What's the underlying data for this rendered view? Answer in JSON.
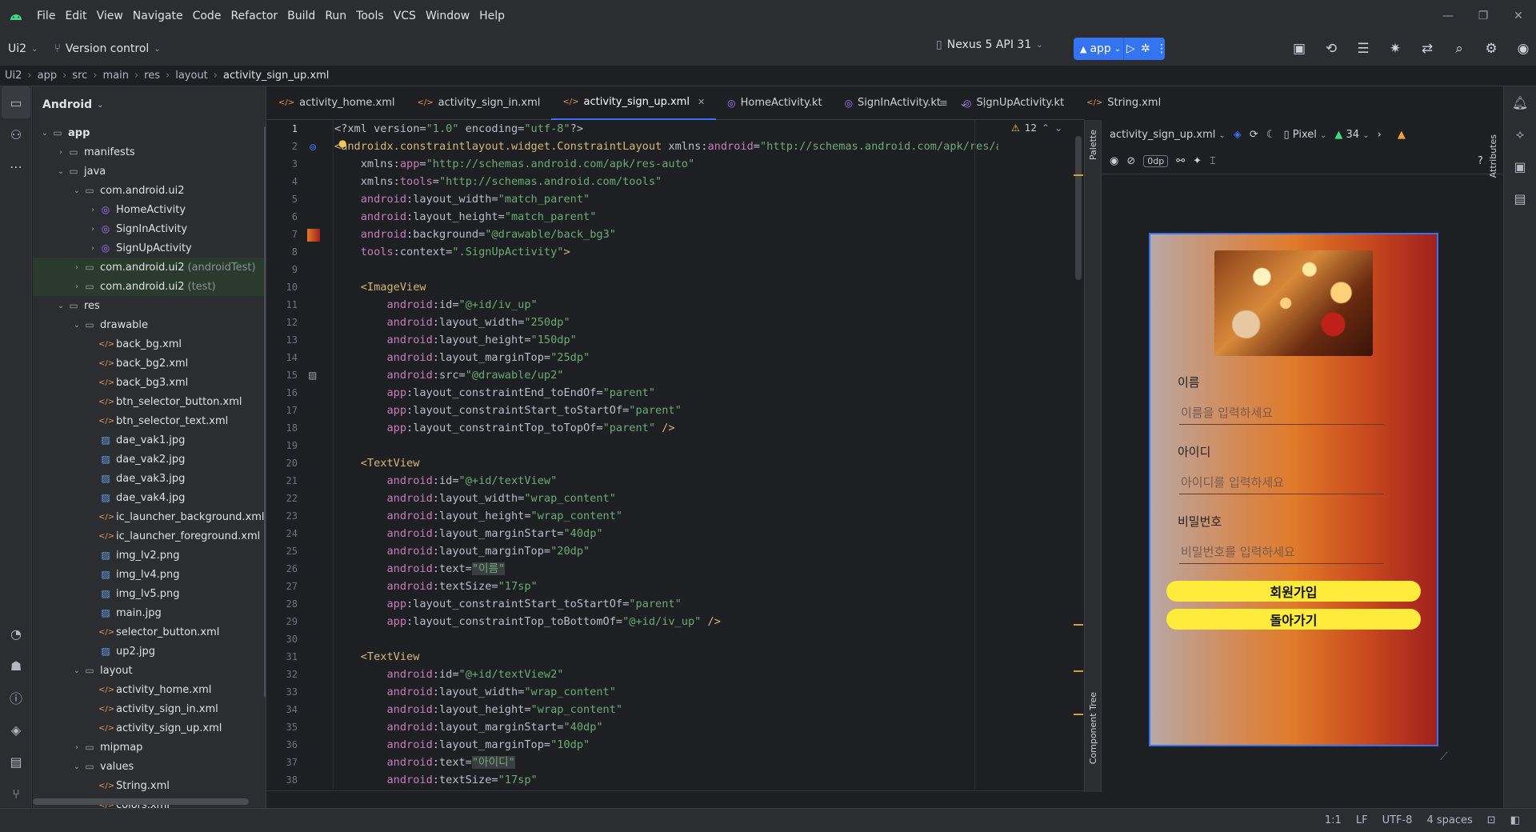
{
  "menubar": {
    "items": [
      "File",
      "Edit",
      "View",
      "Navigate",
      "Code",
      "Refactor",
      "Build",
      "Run",
      "Tools",
      "VCS",
      "Window",
      "Help"
    ]
  },
  "toolbar": {
    "project": "Ui2",
    "vcs": "Version control",
    "device": "Nexus 5 API 31",
    "run_config": "app"
  },
  "breadcrumb": [
    "Ui2",
    "app",
    "src",
    "main",
    "res",
    "layout",
    "activity_sign_up.xml"
  ],
  "project_panel": {
    "title": "Android",
    "tree": [
      {
        "depth": 0,
        "arrow": "v",
        "icon": "folder",
        "label": "app",
        "bold": true
      },
      {
        "depth": 1,
        "arrow": ">",
        "icon": "folder",
        "label": "manifests"
      },
      {
        "depth": 1,
        "arrow": "v",
        "icon": "folder",
        "label": "java"
      },
      {
        "depth": 2,
        "arrow": "v",
        "icon": "folder",
        "label": "com.android.ui2"
      },
      {
        "depth": 3,
        "arrow": ">",
        "icon": "kt",
        "label": "HomeActivity"
      },
      {
        "depth": 3,
        "arrow": ">",
        "icon": "kt",
        "label": "SignInActivity"
      },
      {
        "depth": 3,
        "arrow": ">",
        "icon": "kt",
        "label": "SignUpActivity"
      },
      {
        "depth": 2,
        "arrow": ">",
        "icon": "folder",
        "label": "com.android.ui2",
        "suffix": "(androidTest)",
        "hl": true
      },
      {
        "depth": 2,
        "arrow": ">",
        "icon": "folder",
        "label": "com.android.ui2",
        "suffix": "(test)",
        "hl": true
      },
      {
        "depth": 1,
        "arrow": "v",
        "icon": "folder",
        "label": "res"
      },
      {
        "depth": 2,
        "arrow": "v",
        "icon": "folder",
        "label": "drawable"
      },
      {
        "depth": 3,
        "arrow": "",
        "icon": "xml",
        "label": "back_bg.xml"
      },
      {
        "depth": 3,
        "arrow": "",
        "icon": "xml",
        "label": "back_bg2.xml"
      },
      {
        "depth": 3,
        "arrow": "",
        "icon": "xml",
        "label": "back_bg3.xml"
      },
      {
        "depth": 3,
        "arrow": "",
        "icon": "xml",
        "label": "btn_selector_button.xml"
      },
      {
        "depth": 3,
        "arrow": "",
        "icon": "xml",
        "label": "btn_selector_text.xml"
      },
      {
        "depth": 3,
        "arrow": "",
        "icon": "img",
        "label": "dae_vak1.jpg"
      },
      {
        "depth": 3,
        "arrow": "",
        "icon": "img",
        "label": "dae_vak2.jpg"
      },
      {
        "depth": 3,
        "arrow": "",
        "icon": "img",
        "label": "dae_vak3.jpg"
      },
      {
        "depth": 3,
        "arrow": "",
        "icon": "img",
        "label": "dae_vak4.jpg"
      },
      {
        "depth": 3,
        "arrow": "",
        "icon": "xml",
        "label": "ic_launcher_background.xml"
      },
      {
        "depth": 3,
        "arrow": "",
        "icon": "xml",
        "label": "ic_launcher_foreground.xml"
      },
      {
        "depth": 3,
        "arrow": "",
        "icon": "img",
        "label": "img_lv2.png"
      },
      {
        "depth": 3,
        "arrow": "",
        "icon": "img",
        "label": "img_lv4.png"
      },
      {
        "depth": 3,
        "arrow": "",
        "icon": "img",
        "label": "img_lv5.png"
      },
      {
        "depth": 3,
        "arrow": "",
        "icon": "img",
        "label": "main.jpg"
      },
      {
        "depth": 3,
        "arrow": "",
        "icon": "xml",
        "label": "selector_button.xml"
      },
      {
        "depth": 3,
        "arrow": "",
        "icon": "img",
        "label": "up2.jpg"
      },
      {
        "depth": 2,
        "arrow": "v",
        "icon": "folder",
        "label": "layout"
      },
      {
        "depth": 3,
        "arrow": "",
        "icon": "xml",
        "label": "activity_home.xml"
      },
      {
        "depth": 3,
        "arrow": "",
        "icon": "xml",
        "label": "activity_sign_in.xml"
      },
      {
        "depth": 3,
        "arrow": "",
        "icon": "xml",
        "label": "activity_sign_up.xml"
      },
      {
        "depth": 2,
        "arrow": ">",
        "icon": "folder",
        "label": "mipmap"
      },
      {
        "depth": 2,
        "arrow": "v",
        "icon": "folder",
        "label": "values"
      },
      {
        "depth": 3,
        "arrow": "",
        "icon": "xml",
        "label": "String.xml"
      },
      {
        "depth": 3,
        "arrow": "",
        "icon": "xml",
        "label": "colors.xml"
      }
    ]
  },
  "tabs": [
    {
      "label": "activity_home.xml",
      "type": "xml"
    },
    {
      "label": "activity_sign_in.xml",
      "type": "xml"
    },
    {
      "label": "activity_sign_up.xml",
      "type": "xml",
      "active": true
    },
    {
      "label": "HomeActivity.kt",
      "type": "kt"
    },
    {
      "label": "SignInActivity.kt",
      "type": "kt"
    },
    {
      "label": "SignUpActivity.kt",
      "type": "kt"
    },
    {
      "label": "String.xml",
      "type": "xml"
    }
  ],
  "inspections": {
    "warnings": "12"
  },
  "code_lines": [
    [
      [
        "pi",
        "<?xml version="
      ],
      [
        "vl",
        "\"1.0\""
      ],
      [
        "pi",
        " encoding="
      ],
      [
        "vl",
        "\"utf-8\""
      ],
      [
        "pi",
        "?>"
      ]
    ],
    [
      [
        "tg",
        "<androidx.constraintlayout.widget.ConstraintLayout "
      ],
      [
        "at",
        "xmlns:"
      ],
      [
        "ns",
        "android"
      ],
      [
        "at",
        "="
      ],
      [
        "vl",
        "\"http://schemas.android.com/apk/res/android\""
      ]
    ],
    [
      [
        "at",
        "    xmlns:"
      ],
      [
        "ns",
        "app"
      ],
      [
        "at",
        "="
      ],
      [
        "vl",
        "\"http://schemas.android.com/apk/res-auto\""
      ]
    ],
    [
      [
        "at",
        "    xmlns:"
      ],
      [
        "ns",
        "tools"
      ],
      [
        "at",
        "="
      ],
      [
        "vl",
        "\"http://schemas.android.com/tools\""
      ]
    ],
    [
      [
        "ns",
        "    android"
      ],
      [
        "at",
        ":layout_width="
      ],
      [
        "vl",
        "\"match_parent\""
      ]
    ],
    [
      [
        "ns",
        "    android"
      ],
      [
        "at",
        ":layout_height="
      ],
      [
        "vl",
        "\"match_parent\""
      ]
    ],
    [
      [
        "ns",
        "    android"
      ],
      [
        "at",
        ":background="
      ],
      [
        "vl",
        "\"@drawable/back_bg3\""
      ]
    ],
    [
      [
        "ns",
        "    tools"
      ],
      [
        "at",
        ":context="
      ],
      [
        "vl",
        "\".SignUpActivity\""
      ],
      [
        "tg",
        ">"
      ]
    ],
    [
      [
        "at",
        ""
      ]
    ],
    [
      [
        "tg",
        "    <ImageView"
      ]
    ],
    [
      [
        "ns",
        "        android"
      ],
      [
        "at",
        ":id="
      ],
      [
        "vl",
        "\"@+id/iv_up\""
      ]
    ],
    [
      [
        "ns",
        "        android"
      ],
      [
        "at",
        ":layout_width="
      ],
      [
        "vl",
        "\"250dp\""
      ]
    ],
    [
      [
        "ns",
        "        android"
      ],
      [
        "at",
        ":layout_height="
      ],
      [
        "vl",
        "\"150dp\""
      ]
    ],
    [
      [
        "ns",
        "        android"
      ],
      [
        "at",
        ":layout_marginTop="
      ],
      [
        "vl",
        "\"25dp\""
      ]
    ],
    [
      [
        "ns",
        "        android"
      ],
      [
        "at",
        ":src="
      ],
      [
        "vl",
        "\"@drawable/up2\""
      ]
    ],
    [
      [
        "ns",
        "        app"
      ],
      [
        "at",
        ":layout_constraintEnd_toEndOf="
      ],
      [
        "vl",
        "\"parent\""
      ]
    ],
    [
      [
        "ns",
        "        app"
      ],
      [
        "at",
        ":layout_constraintStart_toStartOf="
      ],
      [
        "vl",
        "\"parent\""
      ]
    ],
    [
      [
        "ns",
        "        app"
      ],
      [
        "at",
        ":layout_constraintTop_toTopOf="
      ],
      [
        "vl",
        "\"parent\""
      ],
      [
        "tg",
        " />"
      ]
    ],
    [
      [
        "at",
        ""
      ]
    ],
    [
      [
        "tg",
        "    <TextView"
      ]
    ],
    [
      [
        "ns",
        "        android"
      ],
      [
        "at",
        ":id="
      ],
      [
        "vl",
        "\"@+id/textView\""
      ]
    ],
    [
      [
        "ns",
        "        android"
      ],
      [
        "at",
        ":layout_width="
      ],
      [
        "vl",
        "\"wrap_content\""
      ]
    ],
    [
      [
        "ns",
        "        android"
      ],
      [
        "at",
        ":layout_height="
      ],
      [
        "vl",
        "\"wrap_content\""
      ]
    ],
    [
      [
        "ns",
        "        android"
      ],
      [
        "at",
        ":layout_marginStart="
      ],
      [
        "vl",
        "\"40dp\""
      ]
    ],
    [
      [
        "ns",
        "        android"
      ],
      [
        "at",
        ":layout_marginTop="
      ],
      [
        "vl",
        "\"20dp\""
      ]
    ],
    [
      [
        "ns",
        "        android"
      ],
      [
        "at",
        ":text="
      ],
      [
        "hl",
        "\"이름\""
      ]
    ],
    [
      [
        "ns",
        "        android"
      ],
      [
        "at",
        ":textSize="
      ],
      [
        "vl",
        "\"17sp\""
      ]
    ],
    [
      [
        "ns",
        "        app"
      ],
      [
        "at",
        ":layout_constraintStart_toStartOf="
      ],
      [
        "vl",
        "\"parent\""
      ]
    ],
    [
      [
        "ns",
        "        app"
      ],
      [
        "at",
        ":layout_constraintTop_toBottomOf="
      ],
      [
        "vl",
        "\"@+id/iv_up\""
      ],
      [
        "tg",
        " />"
      ]
    ],
    [
      [
        "at",
        ""
      ]
    ],
    [
      [
        "tg",
        "    <TextView"
      ]
    ],
    [
      [
        "ns",
        "        android"
      ],
      [
        "at",
        ":id="
      ],
      [
        "vl",
        "\"@+id/textView2\""
      ]
    ],
    [
      [
        "ns",
        "        android"
      ],
      [
        "at",
        ":layout_width="
      ],
      [
        "vl",
        "\"wrap_content\""
      ]
    ],
    [
      [
        "ns",
        "        android"
      ],
      [
        "at",
        ":layout_height="
      ],
      [
        "vl",
        "\"wrap_content\""
      ]
    ],
    [
      [
        "ns",
        "        android"
      ],
      [
        "at",
        ":layout_marginStart="
      ],
      [
        "vl",
        "\"40dp\""
      ]
    ],
    [
      [
        "ns",
        "        android"
      ],
      [
        "at",
        ":layout_marginTop="
      ],
      [
        "vl",
        "\"10dp\""
      ]
    ],
    [
      [
        "ns",
        "        android"
      ],
      [
        "at",
        ":text="
      ],
      [
        "hl",
        "\"아이디\""
      ]
    ],
    [
      [
        "ns",
        "        android"
      ],
      [
        "at",
        ":textSize="
      ],
      [
        "vl",
        "\"17sp\""
      ]
    ]
  ],
  "design": {
    "file_select": "activity_sign_up.xml",
    "device": "Pixel",
    "api": "34",
    "margin": "0dp",
    "palette_label": "Palette",
    "component_tree_label": "Component Tree",
    "attributes_label": "Attributes"
  },
  "phone": {
    "name_label": "이름",
    "name_hint": "이름을 입력하세요",
    "id_label": "아이디",
    "id_hint": "아이디를 입력하세요",
    "pw_label": "비밀번호",
    "pw_hint": "비밀번호를 입력하세요",
    "signup_button": "회원가입",
    "back_button": "돌아가기"
  },
  "status": {
    "position": "1:1",
    "line_sep": "LF",
    "encoding": "UTF-8",
    "indent": "4 spaces"
  },
  "colors": {
    "accent": "#3574f0",
    "button_yellow": "#ffeb3b"
  }
}
